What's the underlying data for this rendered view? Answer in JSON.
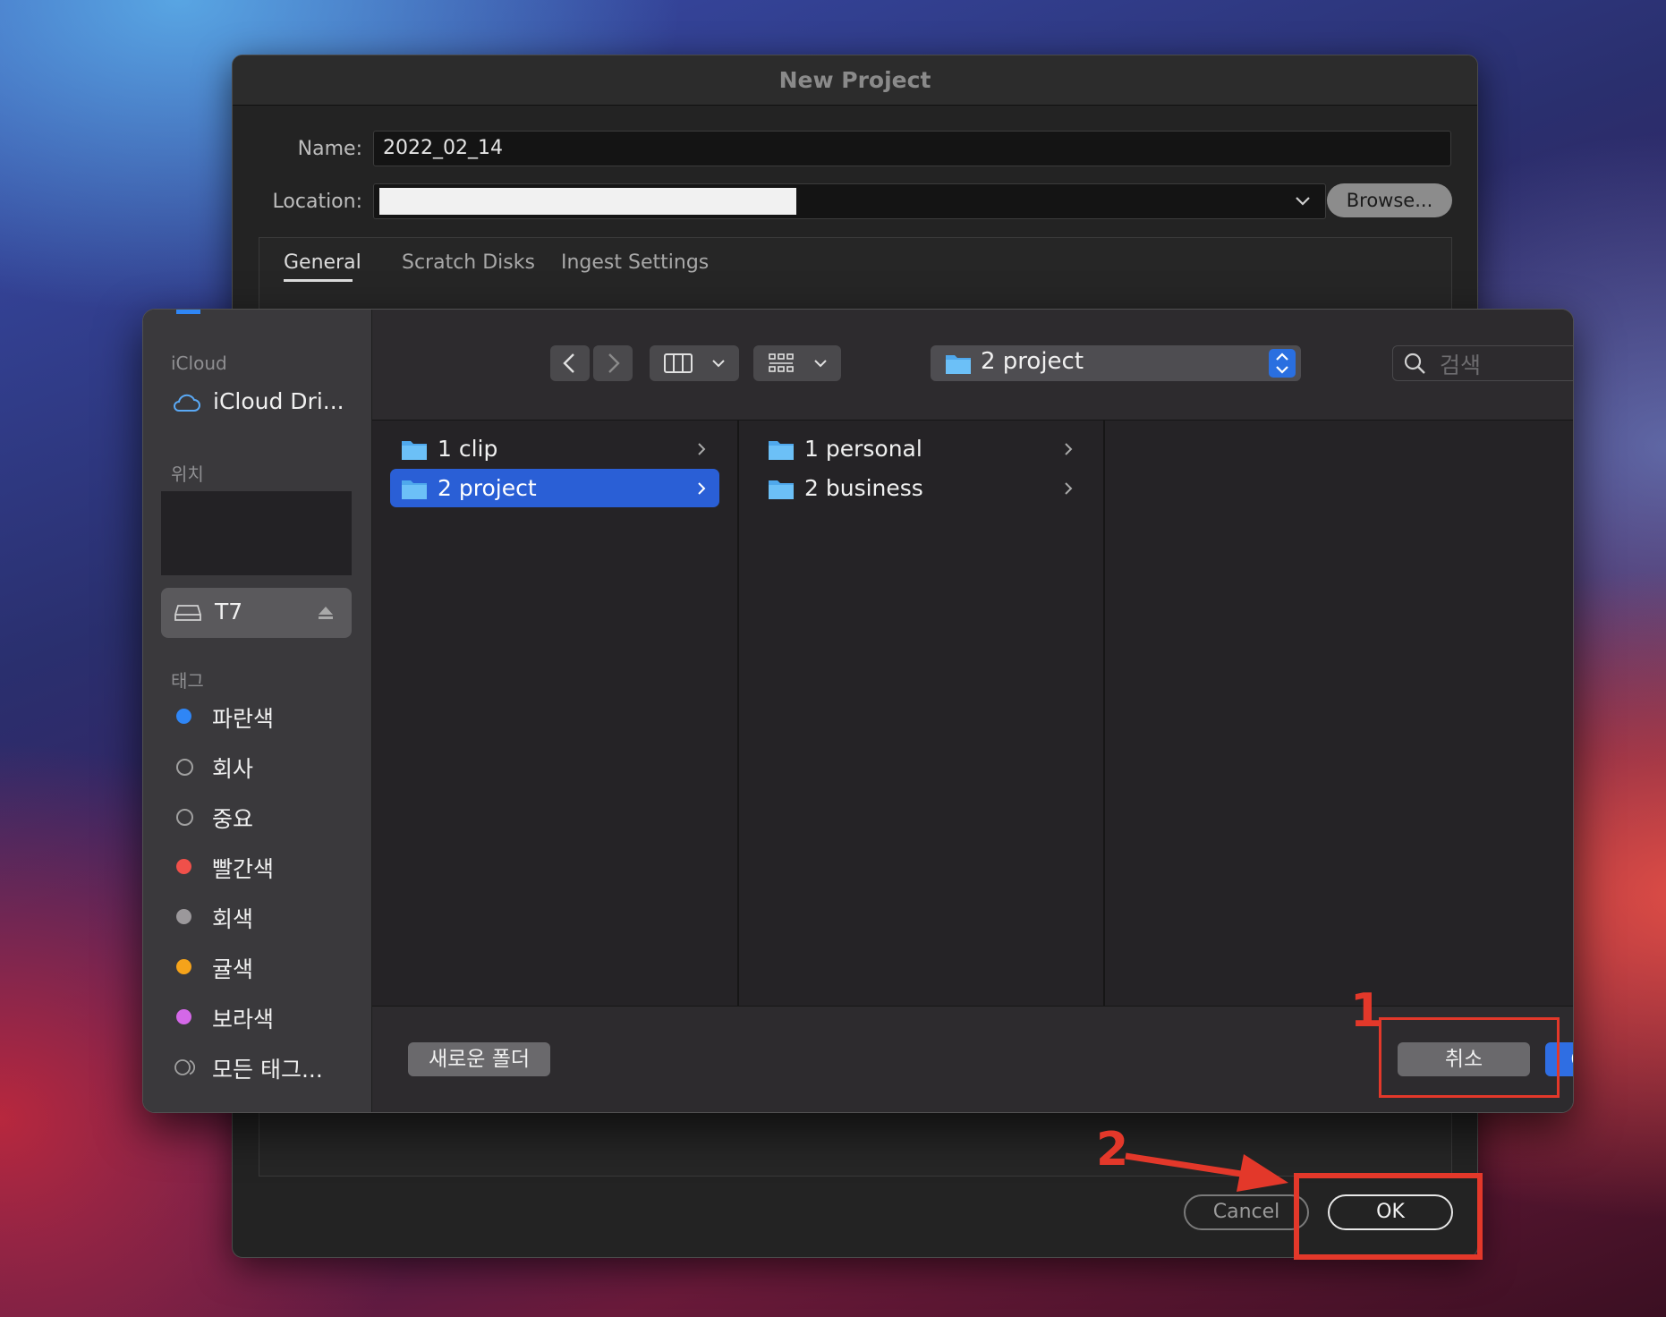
{
  "new_project": {
    "title": "New Project",
    "name_label": "Name:",
    "name_value": "2022_02_14",
    "location_label": "Location:",
    "browse_label": "Browse...",
    "tabs": [
      {
        "label": "General",
        "active": true
      },
      {
        "label": "Scratch Disks",
        "active": false
      },
      {
        "label": "Ingest Settings",
        "active": false
      }
    ],
    "cancel_label": "Cancel",
    "ok_label": "OK"
  },
  "finder": {
    "sidebar": {
      "icloud_header": "iCloud",
      "icloud_drive_label": "iCloud Dri...",
      "locations_header": "위치",
      "t7_label": "T7",
      "tags_header": "태그",
      "tags": [
        {
          "label": "파란색",
          "color": "#2f86f6",
          "style": "dot"
        },
        {
          "label": "회사",
          "color": "#a0a0a0",
          "style": "ring"
        },
        {
          "label": "중요",
          "color": "#a0a0a0",
          "style": "ring"
        },
        {
          "label": "빨간색",
          "color": "#f0504a",
          "style": "dot"
        },
        {
          "label": "회색",
          "color": "#9b989b",
          "style": "dot"
        },
        {
          "label": "귤색",
          "color": "#f5a31a",
          "style": "dot"
        },
        {
          "label": "보라색",
          "color": "#d468e8",
          "style": "dot"
        }
      ],
      "all_tags_label": "모든 태그..."
    },
    "toolbar": {
      "path_label": "2 project",
      "search_placeholder": "검색"
    },
    "column1": [
      {
        "label": "1 clip",
        "selected": false
      },
      {
        "label": "2 project",
        "selected": true
      }
    ],
    "column2": [
      {
        "label": "1 personal",
        "selected": false
      },
      {
        "label": "2 business",
        "selected": false
      }
    ],
    "new_folder_label": "새로운 폴더",
    "cancel_label": "취소",
    "choose_label": "Choose"
  },
  "annotations": {
    "step1": "1",
    "step2": "2",
    "color": "#e3382a"
  }
}
